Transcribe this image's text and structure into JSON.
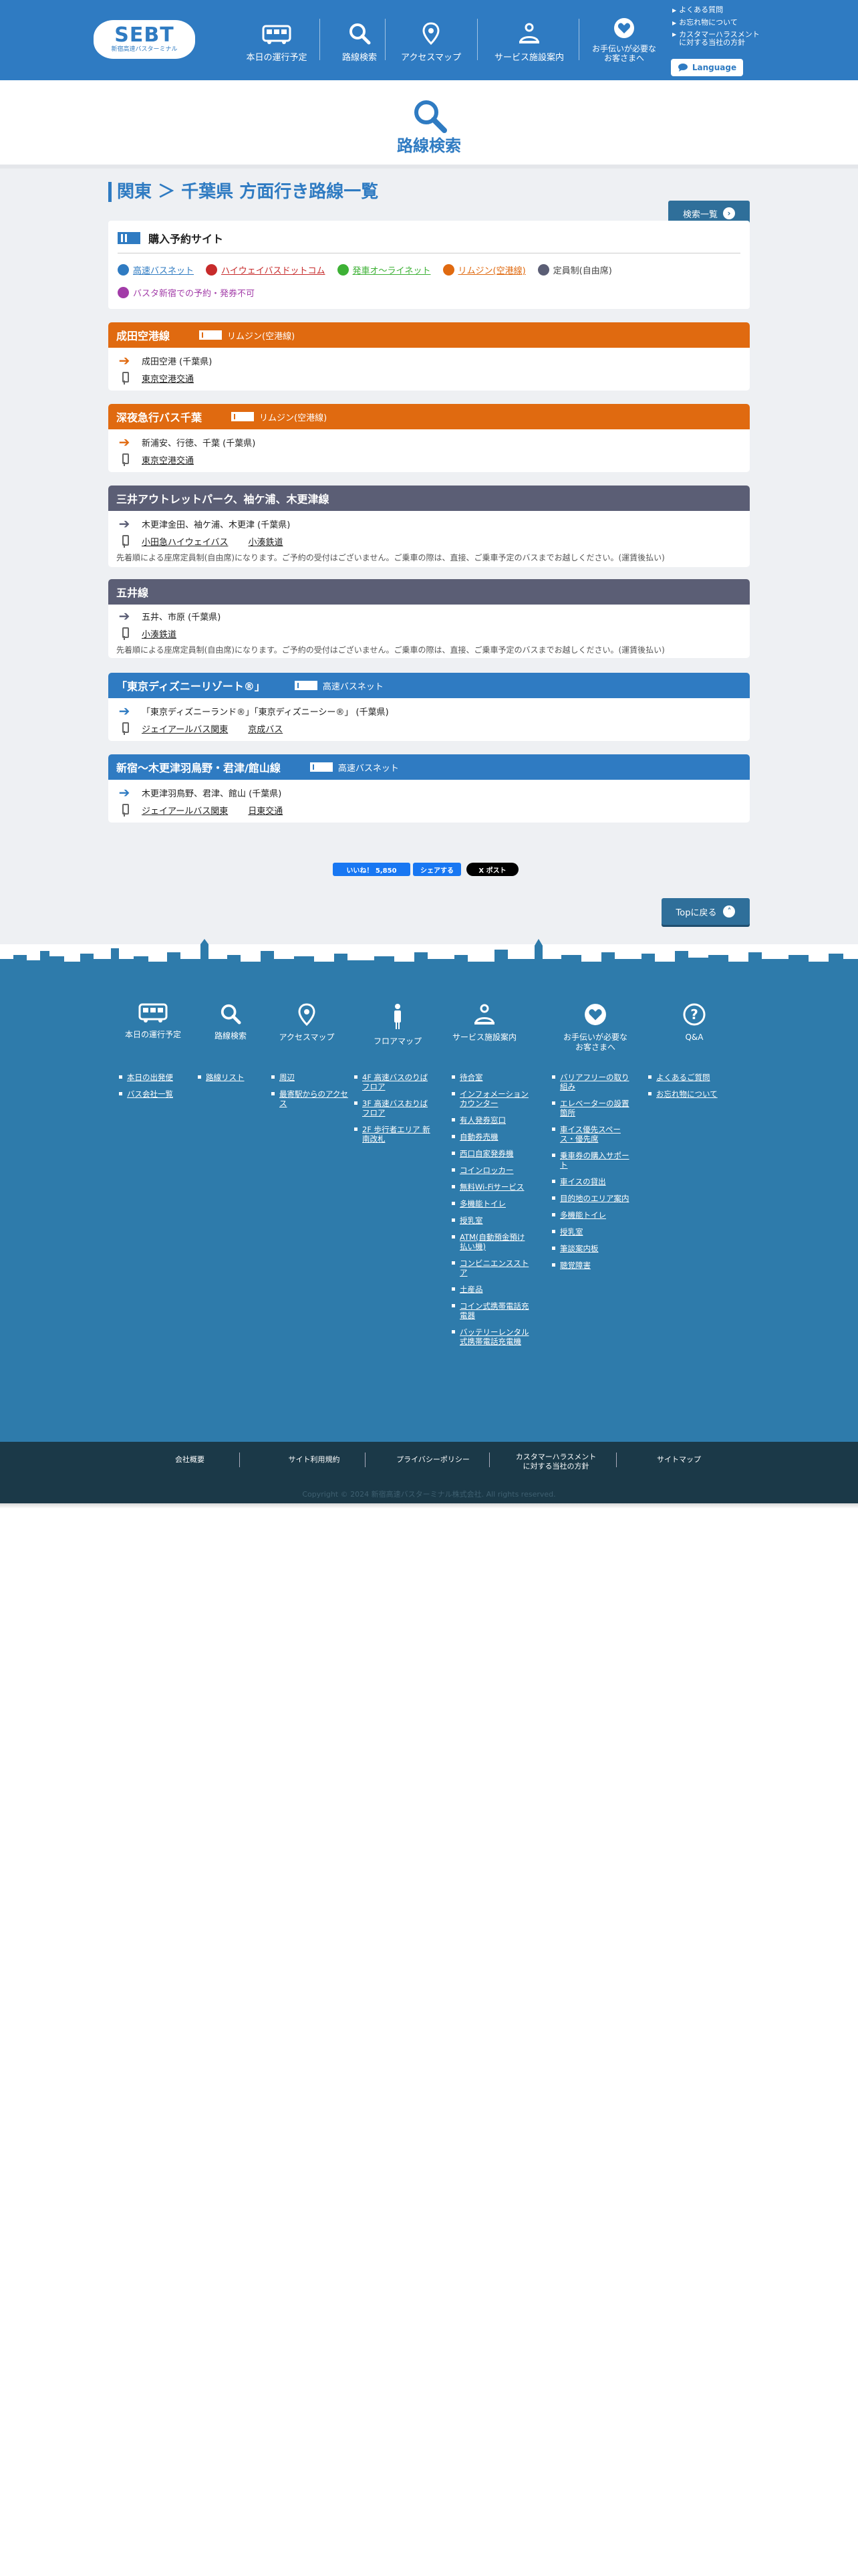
{
  "header": {
    "logo_text": "SEBT",
    "logo_sub": "新宿高速バスターミナル",
    "nav": [
      {
        "label": "本日の運行予定",
        "icon": "bus-icon"
      },
      {
        "label": "路線検索",
        "icon": "search-icon"
      },
      {
        "label": "アクセスマップ",
        "icon": "map-pin-icon"
      },
      {
        "label": "サービス施設案内",
        "icon": "service-icon"
      },
      {
        "label": "お手伝いが必要な\nお客さまへ",
        "icon": "heart-icon"
      }
    ],
    "links": [
      "よくある質問",
      "お忘れ物について",
      "カスタマーハラスメント\nに対する当社の方針"
    ],
    "language_label": "Language"
  },
  "page_title": "路線検索",
  "breadcrumb": {
    "region": "関東",
    "sep": "＞",
    "title": "千葉県 方面行き路線一覧"
  },
  "search_list_button": "検索一覧",
  "purchase": {
    "title": "購入予約サイト",
    "items": [
      {
        "label": "高速バスネット",
        "color": "#2f7bc2"
      },
      {
        "label": "ハイウェイバスドットコム",
        "color": "#c72b2b"
      },
      {
        "label": "発車オ～ライネット",
        "color": "#3db135"
      },
      {
        "label": "リムジン(空港線)",
        "color": "#e06a10"
      },
      {
        "label": "定員制(自由席)",
        "color": "#5b5e75"
      },
      {
        "label": "バスタ新宿での予約・発券不可",
        "color": "#a23ca8"
      }
    ]
  },
  "routes": [
    {
      "name": "成田空港線",
      "color": "#e06a10",
      "tag": "リムジン(空港線)",
      "dest": "成田空港 (千葉県)",
      "operators": [
        "東京空港交通"
      ],
      "note": ""
    },
    {
      "name": "深夜急行バス千葉",
      "color": "#e06a10",
      "tag": "リムジン(空港線)",
      "dest": "新浦安、行徳、千葉 (千葉県)",
      "operators": [
        "東京空港交通"
      ],
      "note": ""
    },
    {
      "name": "三井アウトレットパーク、袖ケ浦、木更津線",
      "color": "#5b5e75",
      "tag": "",
      "dest": "木更津金田、袖ケ浦、木更津 (千葉県)",
      "operators": [
        "小田急ハイウェイバス",
        "小湊鉄道"
      ],
      "note": "先着順による座席定員制(自由席)になります。ご予約の受付はございません。ご乗車の際は、直接、ご乗車予定のバスまでお越しください。(運賃後払い)"
    },
    {
      "name": "五井線",
      "color": "#5b5e75",
      "tag": "",
      "dest": "五井、市原 (千葉県)",
      "operators": [
        "小湊鉄道"
      ],
      "note": "先着順による座席定員制(自由席)になります。ご予約の受付はございません。ご乗車の際は、直接、ご乗車予定のバスまでお越しください。(運賃後払い)"
    },
    {
      "name": "「東京ディズニーリゾート®」",
      "color": "#2f7bc2",
      "tag": "高速バスネット",
      "dest": "「東京ディズニーランド®」「東京ディズニーシー®」 (千葉県)",
      "operators": [
        "ジェイアールバス関東",
        "京成バス"
      ],
      "note": ""
    },
    {
      "name": "新宿～木更津羽鳥野・君津/館山線",
      "color": "#2f7bc2",
      "tag": "高速バスネット",
      "dest": "木更津羽鳥野、君津、館山 (千葉県)",
      "operators": [
        "ジェイアールバス関東",
        "日東交通"
      ],
      "note": ""
    }
  ],
  "social": {
    "like": "いいね！ 5,850",
    "share": "シェアする",
    "post": "X ポスト"
  },
  "top_button": "Topに戻る",
  "footer": {
    "cols": [
      {
        "label": "本日の運行予定",
        "items": [
          "本日の出発便",
          "バス会社一覧"
        ]
      },
      {
        "label": "路線検索",
        "items": [
          "路線リスト"
        ]
      },
      {
        "label": "アクセスマップ",
        "items": [
          "周辺",
          "最寄駅からのアクセス"
        ]
      },
      {
        "label": "フロアマップ",
        "items": [
          "4F 高速バスのりばフロア",
          "3F 高速バスおりばフロア",
          "2F 歩行者エリア 新南改札"
        ]
      },
      {
        "label": "サービス施設案内",
        "items": [
          "待合室",
          "インフォメーションカウンター",
          "有人発券窓口",
          "自動券売機",
          "西口自家発券機",
          "コインロッカー",
          "無料Wi-Fiサービス",
          "多機能トイレ",
          "授乳室",
          "ATM(自動預金預け払い機)",
          "コンビニエンスストア",
          "土産品",
          "コイン式携帯電話充電器",
          "バッテリーレンタル式携帯電話充電機"
        ]
      },
      {
        "label": "お手伝いが必要な\nお客さまへ",
        "items": [
          "バリアフリーの取り組み",
          "エレベーターの設置箇所",
          "車イス優先スペース・優先席",
          "乗車券の購入サポート",
          "車イスの貸出",
          "目的地のエリア案内",
          "多機能トイレ",
          "授乳室",
          "筆談案内板",
          "聴覚障害"
        ]
      },
      {
        "label": "Q&A",
        "items": [
          "よくあるご質問",
          "お忘れ物について"
        ]
      }
    ],
    "bottom_links": [
      "会社概要",
      "サイト利用規約",
      "プライバシーポリシー",
      "カスタマーハラスメント\nに対する当社の方針",
      "サイトマップ"
    ],
    "copyright": "Copyright © 2024 新宿高速バスターミナル株式会社. All rights reserved."
  }
}
